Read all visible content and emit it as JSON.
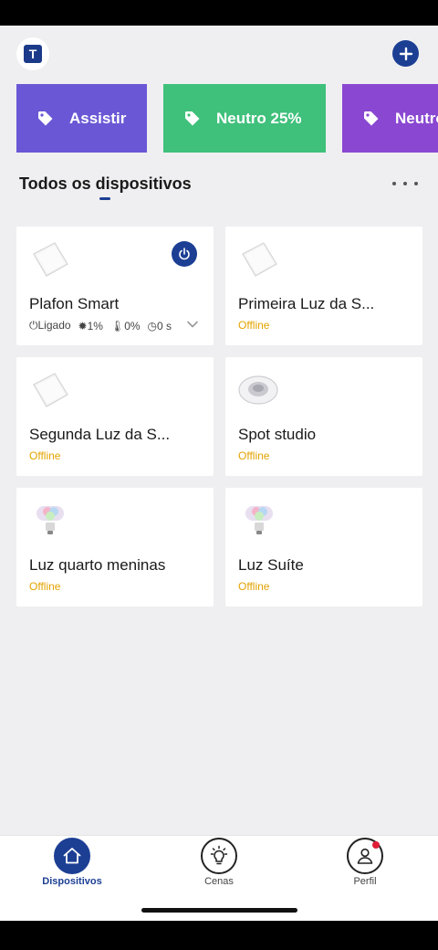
{
  "header": {
    "logo_letter": "T",
    "add_icon": "plus-icon"
  },
  "scenes": [
    {
      "label": "Assistir",
      "color": "#6a57d5",
      "icon": "tag-icon"
    },
    {
      "label": "Neutro 25%",
      "color": "#3fc07b",
      "icon": "tag-icon"
    },
    {
      "label": "Neutro",
      "color": "#8a47d2",
      "icon": "tag-icon"
    }
  ],
  "section": {
    "title": "Todos os dispositivos",
    "more_icon": "more-dots-icon"
  },
  "devices": [
    {
      "name": "Plafon Smart",
      "kind": "panel",
      "online": true,
      "stats": {
        "power": "Ligado",
        "brightness": "1%",
        "temperature": "0%",
        "timer": "0 s"
      }
    },
    {
      "name": "Primeira Luz da S...",
      "kind": "panel",
      "status": "Offline"
    },
    {
      "name": "Segunda Luz da S...",
      "kind": "panel",
      "status": "Offline"
    },
    {
      "name": "Spot studio",
      "kind": "spot",
      "status": "Offline"
    },
    {
      "name": "Luz quarto meninas",
      "kind": "bulb",
      "status": "Offline"
    },
    {
      "name": "Luz Suíte",
      "kind": "bulb",
      "status": "Offline"
    }
  ],
  "tabbar": {
    "tabs": [
      {
        "label": "Dispositivos",
        "icon": "home-icon",
        "active": true
      },
      {
        "label": "Cenas",
        "icon": "bulb-icon",
        "active": false
      },
      {
        "label": "Perfil",
        "icon": "user-icon",
        "active": false,
        "badge": true
      }
    ]
  },
  "colors": {
    "accent": "#1c3f94",
    "offline": "#e3a300",
    "badge": "#e01e37"
  }
}
